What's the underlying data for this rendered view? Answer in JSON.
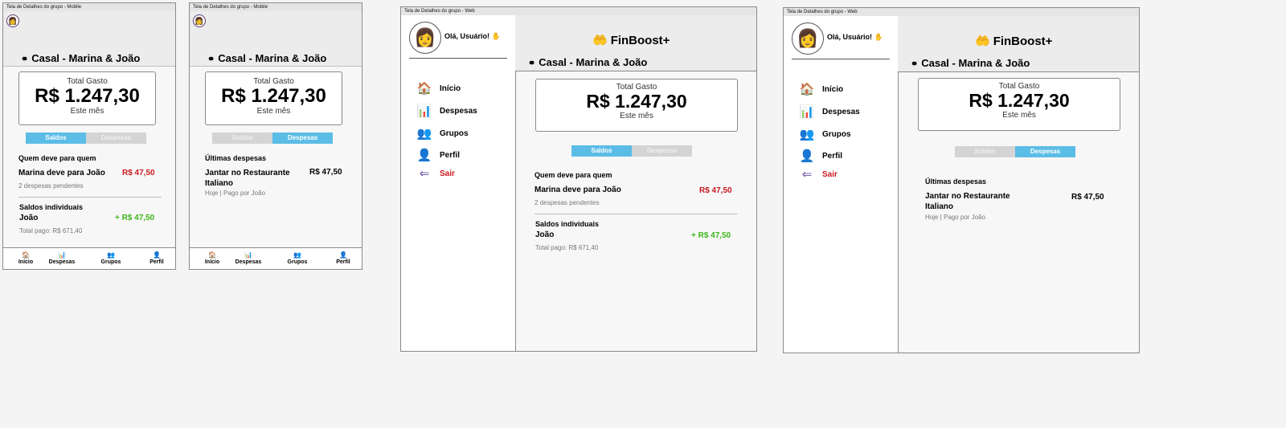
{
  "frames": {
    "mobile_label": "Tela de Detalhes do grupo - Mobile",
    "web_label": "Tela de Detalhes do grupo - Web"
  },
  "group": {
    "title": "Casal - Marina & João"
  },
  "total": {
    "label": "Total Gasto",
    "amount": "R$ 1.247,30",
    "period": "Este mês"
  },
  "tabs": {
    "balances": "Saldos",
    "expenses": "Despesas"
  },
  "balances": {
    "heading": "Quem deve para quem",
    "debt_text": "Marina deve para João",
    "debt_amount": "R$ 47,50",
    "pending": "2 despesas pendentes",
    "individual_heading": "Saldos individuais",
    "person": "João",
    "person_amount": "+ R$ 47,50",
    "total_paid": "Total pago: R$ 671,40"
  },
  "expenses": {
    "heading": "Últimas despesas",
    "item_name": "Jantar no Restaurante Italiano",
    "item_amount": "R$ 47,50",
    "item_meta": "Hoje | Pago por João"
  },
  "bottom_nav": [
    "Início",
    "Despesas",
    "Grupos",
    "Perfil"
  ],
  "sidebar": {
    "greeting": "Olá, Usuário! ✋",
    "items": [
      "Início",
      "Despesas",
      "Grupos",
      "Perfil",
      "Sair"
    ],
    "logout_color": "#c8181e"
  },
  "brand": {
    "name": "FinBoost+"
  },
  "colors": {
    "tab_active": "#5bbde6",
    "tab_inactive": "#d4d4d4",
    "negative": "#c8181e",
    "positive": "#3fb51c"
  },
  "icons": {
    "home": "house-icon",
    "expenses": "bar-chart-icon",
    "groups": "people-icon",
    "profile": "person-icon",
    "logout": "end-arrow-icon",
    "brand": "money-hand-icon",
    "group": "binoculars-icon"
  }
}
